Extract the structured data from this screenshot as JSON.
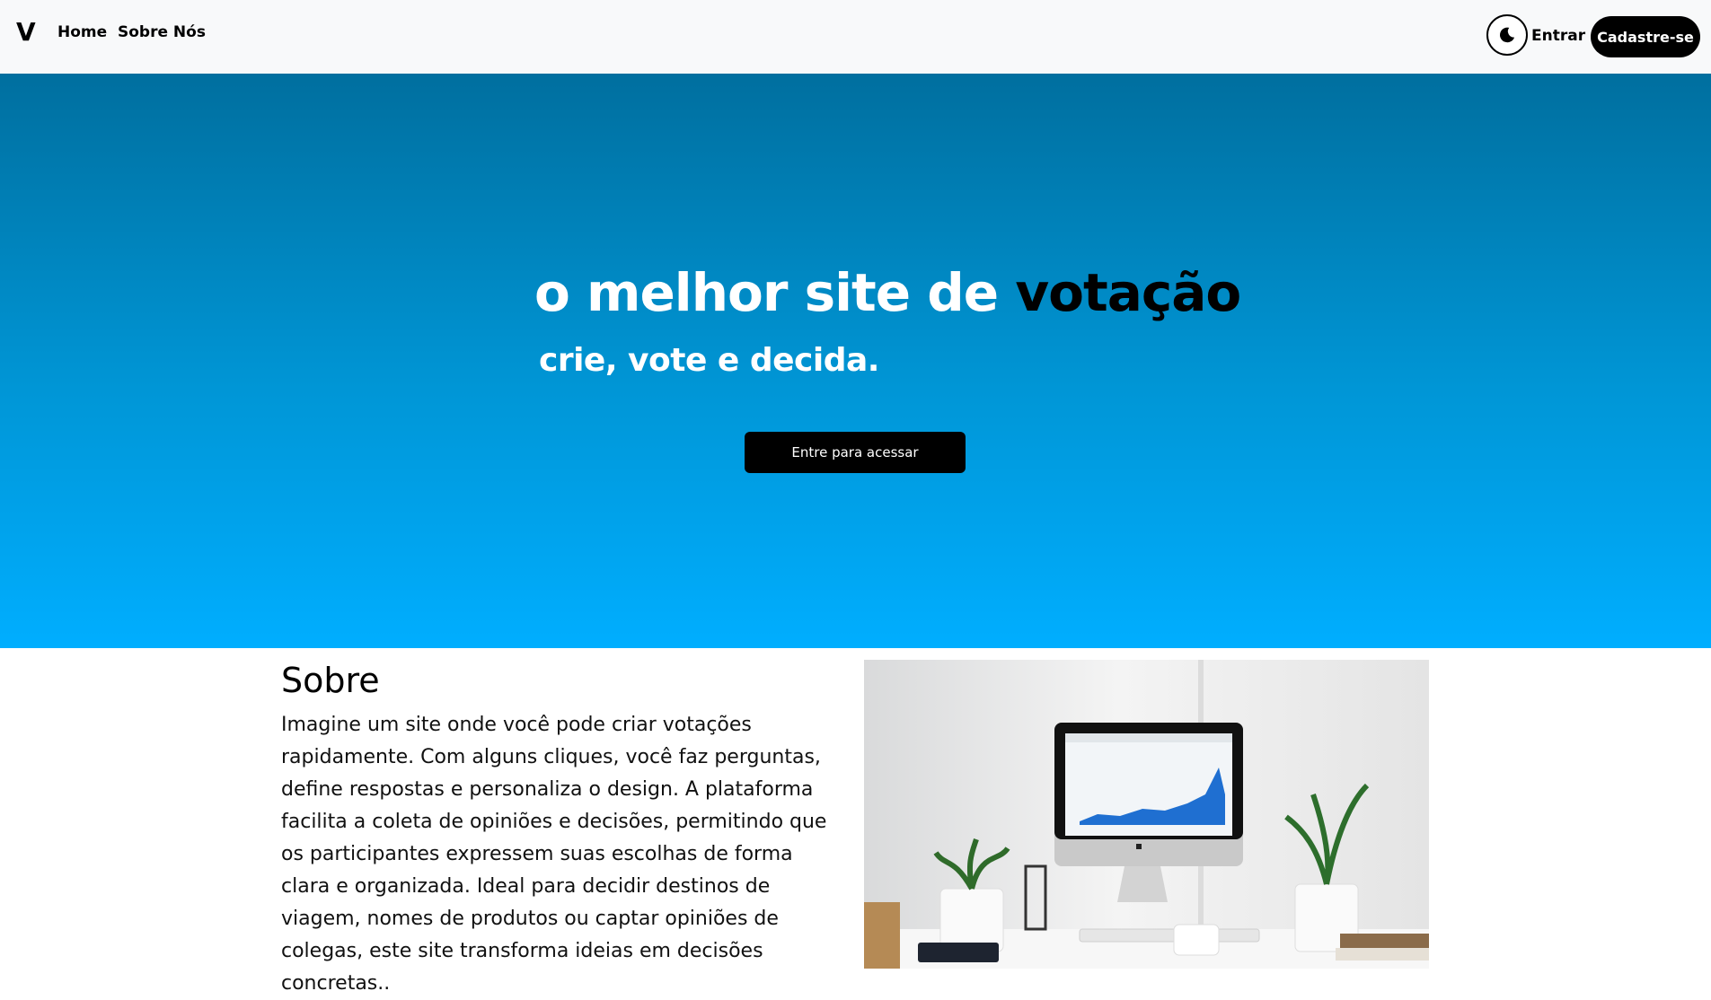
{
  "navbar": {
    "brand": "V",
    "links": [
      "Home",
      "Sobre Nós"
    ],
    "theme_icon": "moon-icon",
    "login_label": "Entrar",
    "signup_label": "Cadastre-se"
  },
  "hero": {
    "title_main": "o melhor site de ",
    "title_accent": "votação",
    "subtitle": "crie, vote e decida.",
    "cta_label": "Entre para acessar",
    "gradient": [
      "#006f9f",
      "#00aeff"
    ]
  },
  "about": {
    "title": "Sobre",
    "text": "Imagine um site onde você pode criar votações rapidamente. Com alguns cliques, você faz perguntas, define respostas e personaliza o design. A plataforma facilita a coleta de opiniões e decisões, permitindo que os participantes expressem suas escolhas de forma clara e organizada. Ideal para decidir destinos de viagem, nomes de produtos ou captar opiniões de colegas, este site transforma ideias em decisões concretas..",
    "image_icon": "desk-computer-image"
  }
}
